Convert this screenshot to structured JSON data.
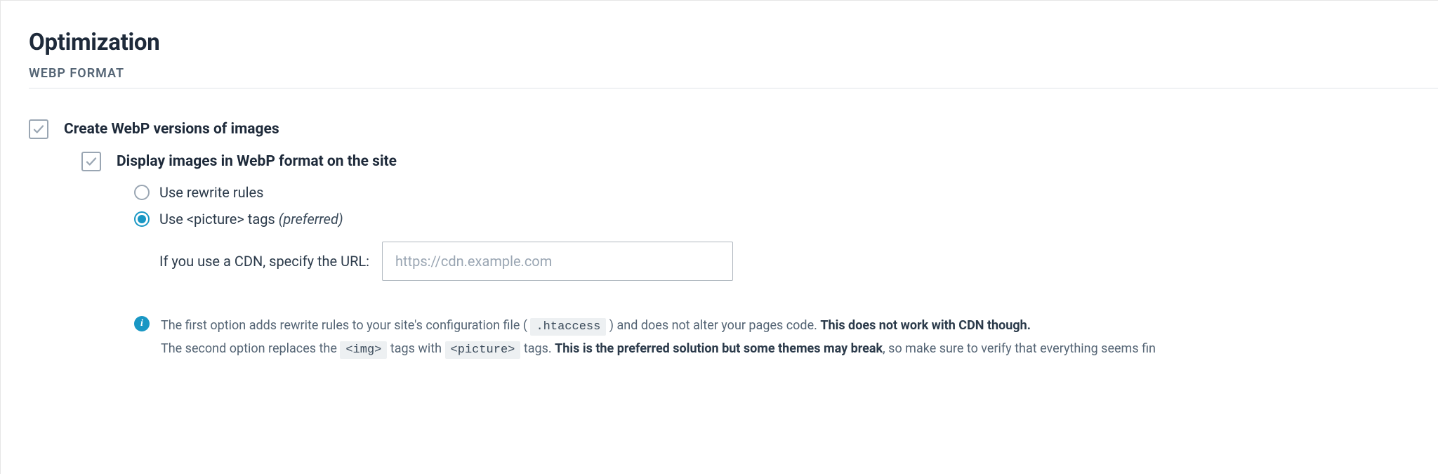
{
  "heading": "Optimization",
  "subheading": "WEBP FORMAT",
  "option1": {
    "label": "Create WebP versions of images",
    "checked": true
  },
  "option2": {
    "label": "Display images in WebP format on the site",
    "checked": true
  },
  "radios": {
    "rewrite": {
      "label": "Use rewrite rules",
      "selected": false
    },
    "picture": {
      "prefix": "Use <picture> tags ",
      "suffix": "(preferred)",
      "selected": true
    }
  },
  "cdn": {
    "label": "If you use a CDN, specify the URL:",
    "placeholder": "https://cdn.example.com",
    "value": ""
  },
  "info": {
    "line1_a": "The first option adds rewrite rules to your site's configuration file ( ",
    "line1_code": ".htaccess",
    "line1_b": " ) and does not alter your pages code. ",
    "line1_bold": "This does not work with CDN though.",
    "line2_a": "The second option replaces the ",
    "line2_code1": "<img>",
    "line2_b": " tags with ",
    "line2_code2": "<picture>",
    "line2_c": " tags. ",
    "line2_bold": "This is the preferred solution but some themes may break",
    "line2_d": ", so make sure to verify that everything seems fin"
  }
}
